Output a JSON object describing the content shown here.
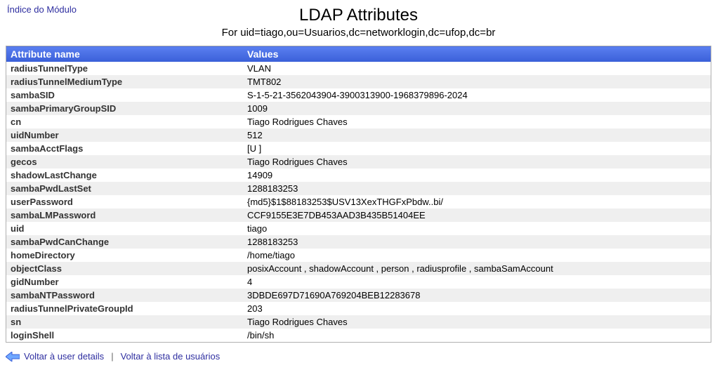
{
  "nav": {
    "module_index": "Índice do Módulo"
  },
  "header": {
    "title": "LDAP Attributes",
    "subtitle": "For uid=tiago,ou=Usuarios,dc=networklogin,dc=ufop,dc=br"
  },
  "table": {
    "col_name": "Attribute name",
    "col_value": "Values",
    "rows": [
      {
        "name": "radiusTunnelType",
        "value": "VLAN"
      },
      {
        "name": "radiusTunnelMediumType",
        "value": "TMT802"
      },
      {
        "name": "sambaSID",
        "value": "S-1-5-21-3562043904-3900313900-1968379896-2024"
      },
      {
        "name": "sambaPrimaryGroupSID",
        "value": "1009"
      },
      {
        "name": "cn",
        "value": "Tiago Rodrigues Chaves"
      },
      {
        "name": "uidNumber",
        "value": "512"
      },
      {
        "name": "sambaAcctFlags",
        "value": "[U ]"
      },
      {
        "name": "gecos",
        "value": "Tiago Rodrigues Chaves"
      },
      {
        "name": "shadowLastChange",
        "value": "14909"
      },
      {
        "name": "sambaPwdLastSet",
        "value": "1288183253"
      },
      {
        "name": "userPassword",
        "value": "{md5}$1$88183253$USV13XexTHGFxPbdw..bi/"
      },
      {
        "name": "sambaLMPassword",
        "value": "CCF9155E3E7DB453AAD3B435B51404EE"
      },
      {
        "name": "uid",
        "value": "tiago"
      },
      {
        "name": "sambaPwdCanChange",
        "value": "1288183253"
      },
      {
        "name": "homeDirectory",
        "value": "/home/tiago"
      },
      {
        "name": "objectClass",
        "value": "posixAccount , shadowAccount , person , radiusprofile , sambaSamAccount"
      },
      {
        "name": "gidNumber",
        "value": "4"
      },
      {
        "name": "sambaNTPassword",
        "value": "3DBDE697D71690A769204BEB12283678"
      },
      {
        "name": "radiusTunnelPrivateGroupId",
        "value": "203"
      },
      {
        "name": "sn",
        "value": "Tiago Rodrigues Chaves"
      },
      {
        "name": "loginShell",
        "value": "/bin/sh"
      }
    ]
  },
  "footer": {
    "back_user": "Voltar à user details",
    "back_list": "Voltar à lista de usuários"
  }
}
